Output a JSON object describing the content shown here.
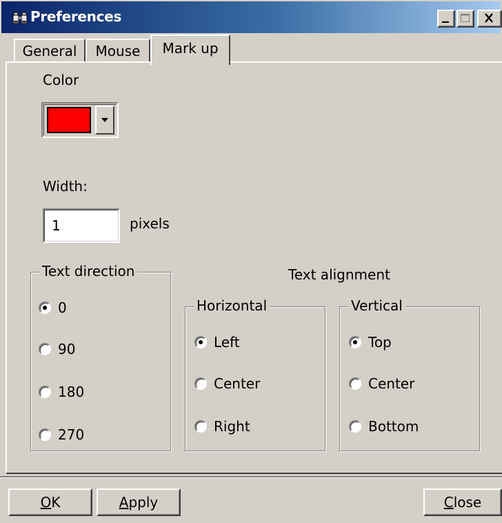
{
  "window": {
    "title": "Preferences",
    "icon": "binoculars-icon",
    "controls": [
      "minimize",
      "maximize",
      "close"
    ]
  },
  "tabs": [
    {
      "label": "General",
      "active": false
    },
    {
      "label": "Mouse",
      "active": false
    },
    {
      "label": "Mark up",
      "active": true
    }
  ],
  "markup": {
    "color_label": "Color",
    "color_value": "#ff0000",
    "width_label": "Width:",
    "width_value": "1",
    "width_unit": "pixels",
    "text_direction": {
      "title": "Text direction",
      "options": [
        "0",
        "90",
        "180",
        "270"
      ],
      "selected": "0"
    },
    "text_alignment": {
      "title": "Text alignment",
      "horizontal": {
        "title": "Horizontal",
        "options": [
          "Left",
          "Center",
          "Right"
        ],
        "selected": "Left"
      },
      "vertical": {
        "title": "Vertical",
        "options": [
          "Top",
          "Center",
          "Bottom"
        ],
        "selected": "Top"
      }
    }
  },
  "buttons": {
    "ok": {
      "prefix": "",
      "mnemonic": "O",
      "rest": "K"
    },
    "apply": {
      "prefix": "",
      "mnemonic": "A",
      "rest": "pply"
    },
    "close": {
      "prefix": "",
      "mnemonic": "C",
      "rest": "lose"
    }
  }
}
